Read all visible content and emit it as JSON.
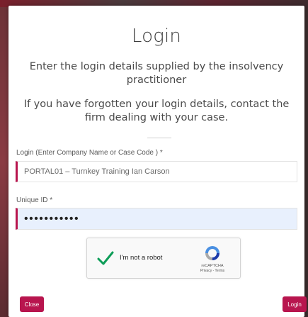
{
  "modal": {
    "title": "Login",
    "subtitle": "Enter the login details supplied by the insolvency practitioner",
    "help_text": "If you have forgotten your login details, contact the firm dealing with your case."
  },
  "form": {
    "login_label": "Login (Enter Company Name or Case Code ) *",
    "login_value": "PORTAL01 – Turnkey Training Ian Carson",
    "uid_label": "Unique ID *",
    "uid_value": "•••••••••••"
  },
  "captcha": {
    "label": "I'm not a robot",
    "brand": "reCAPTCHA",
    "links": "Privacy - Terms",
    "checked": true
  },
  "buttons": {
    "close_label": "Close",
    "login_label": "Login"
  },
  "colors": {
    "accent": "#b8154e",
    "check": "#0d9d58",
    "field_autofill": "#e8f0fd"
  }
}
